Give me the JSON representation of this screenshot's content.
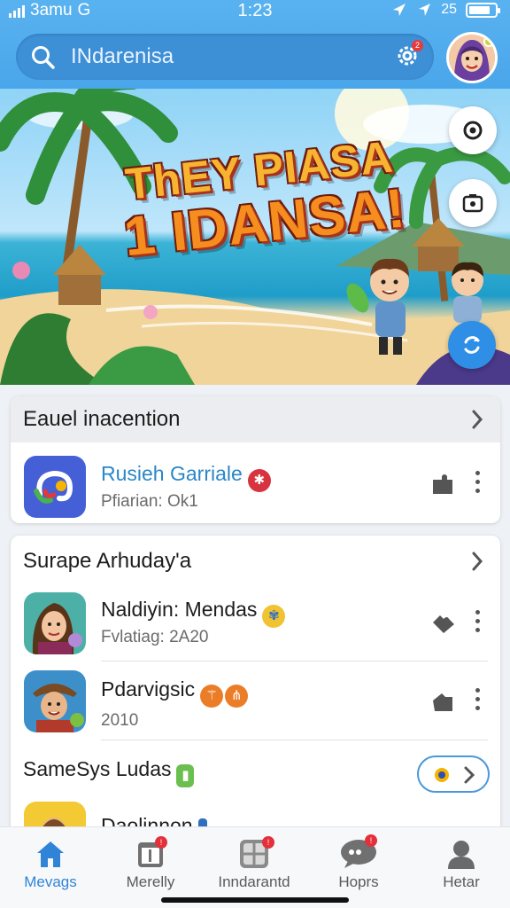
{
  "status_bar": {
    "carrier": "3amu",
    "network_glyph": "G",
    "time": "1:23",
    "signal_text": "25"
  },
  "search": {
    "placeholder": "INdarenisa",
    "notification_count": "2"
  },
  "hero": {
    "title_line1": "ThEY PIASA",
    "title_line2": "1 IDANSA!"
  },
  "section1": {
    "title": "Eauel inacention",
    "apps": [
      {
        "title": "Rusieh Garriale",
        "subtitle": "Pfiarian: Ok1",
        "badge_color": "#d8343f"
      }
    ]
  },
  "section2": {
    "title": "Surape Arhuday'a",
    "apps": [
      {
        "title": "Naldiyin: Mendas",
        "subtitle": "Fvlatiag: 2A20",
        "badge_color": "#f1c232"
      },
      {
        "title": "Pdarvigsic",
        "subtitle": "2010",
        "badge_color": "#ec7d28"
      }
    ],
    "sub_title": "SameSys Ludas",
    "partial_app_title": "Daolinnon"
  },
  "bottom_nav": [
    {
      "label": "Mevags",
      "icon": "home-icon"
    },
    {
      "label": "Merelly",
      "icon": "calendar-icon",
      "badge": "!"
    },
    {
      "label": "Inndarantd",
      "icon": "grid-icon",
      "badge": "!"
    },
    {
      "label": "Hoprs",
      "icon": "chat-icon",
      "badge": "!"
    },
    {
      "label": "Hetar",
      "icon": "profile-icon"
    }
  ],
  "colors": {
    "accent": "#2f84d8",
    "header": "#4aa6ea",
    "badge_red": "#e3303b"
  }
}
